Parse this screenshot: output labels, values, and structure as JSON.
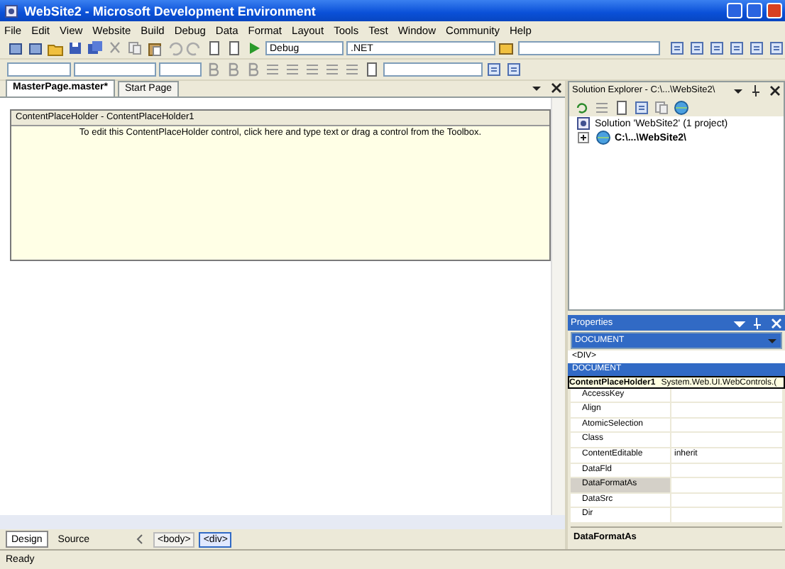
{
  "window": {
    "title": "WebSite2 - Microsoft Development Environment"
  },
  "menu": [
    "File",
    "Edit",
    "View",
    "Website",
    "Build",
    "Debug",
    "Data",
    "Format",
    "Layout",
    "Tools",
    "Test",
    "Window",
    "Community",
    "Help"
  ],
  "toolbar": {
    "configuration": "Debug",
    "platform": ".NET"
  },
  "doc_tabs": [
    {
      "label": "MasterPage.master*",
      "selected": true
    },
    {
      "label": "Start Page",
      "selected": false
    }
  ],
  "designer": {
    "placeholder_title": "ContentPlaceHolder - ContentPlaceHolder1",
    "placeholder_hint": "To edit this ContentPlaceHolder control, click here and type text or drag a control from the Toolbox."
  },
  "solution_explorer": {
    "title": "Solution Explorer - C:\\...\\WebSite2\\",
    "tree": [
      {
        "label": "Solution 'WebSite2' (1 project)",
        "children": [
          {
            "label": "C:\\...\\WebSite2\\",
            "expanded": false
          }
        ]
      }
    ]
  },
  "properties": {
    "title": "Properties",
    "object": "DOCUMENT",
    "object_list": [
      {
        "label": "<DIV>",
        "selected": false
      },
      {
        "label": "DOCUMENT",
        "selected": true
      }
    ],
    "tooltip": {
      "name": "ContentPlaceHolder1",
      "type": "System.Web.UI.WebControls.("
    },
    "rows": [
      {
        "name": "AccessKey",
        "value": "",
        "selected": false
      },
      {
        "name": "Align",
        "value": "",
        "selected": false
      },
      {
        "name": "AtomicSelection",
        "value": "",
        "selected": false
      },
      {
        "name": "Class",
        "value": "",
        "selected": false
      },
      {
        "name": "ContentEditable",
        "value": "inherit",
        "selected": false
      },
      {
        "name": "DataFld",
        "value": "",
        "selected": false
      },
      {
        "name": "DataFormatAs",
        "value": "",
        "selected": true
      },
      {
        "name": "DataSrc",
        "value": "",
        "selected": false
      },
      {
        "name": "Dir",
        "value": "",
        "selected": false
      }
    ],
    "description": "DataFormatAs"
  },
  "view_tabs": [
    {
      "label": "Design",
      "selected": true
    },
    {
      "label": "Source",
      "selected": false
    }
  ],
  "tag_path": [
    {
      "label": "<body>",
      "selected": false
    },
    {
      "label": "<div>",
      "selected": true
    }
  ],
  "status_bar": "Ready"
}
